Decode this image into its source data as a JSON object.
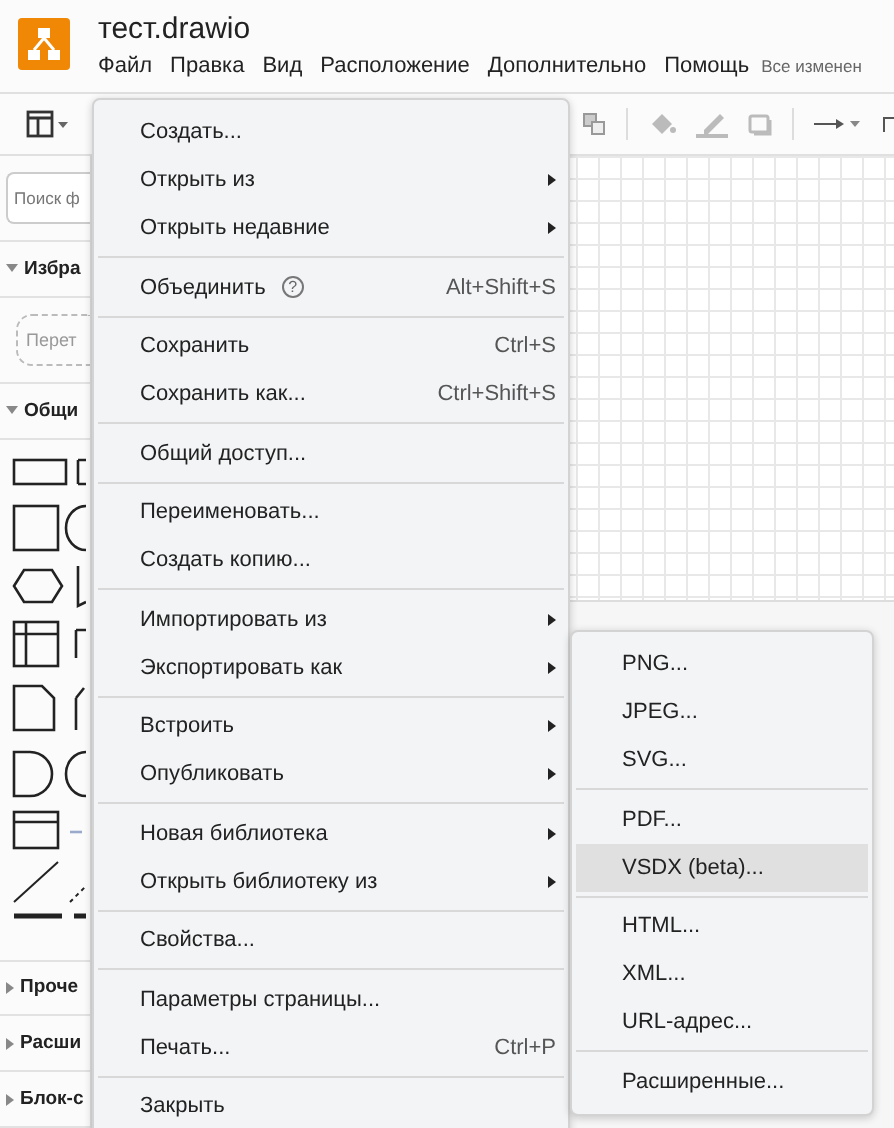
{
  "window": {
    "title": "тест.drawio"
  },
  "menubar": [
    {
      "label": "Файл"
    },
    {
      "label": "Правка"
    },
    {
      "label": "Вид"
    },
    {
      "label": "Расположение"
    },
    {
      "label": "Дополнительно"
    },
    {
      "label": "Помощь"
    }
  ],
  "save_status": "Все изменен",
  "sidebar": {
    "search": {
      "placeholder": "Поиск ф"
    },
    "sections": [
      {
        "title": "Избра",
        "expanded": true,
        "drop_hint": "Перет"
      },
      {
        "title": "Общи",
        "expanded": true,
        "shapes": true
      },
      {
        "title": "Проче",
        "expanded": false
      },
      {
        "title": "Расши",
        "expanded": false
      },
      {
        "title": "Блок-с",
        "expanded": false
      }
    ]
  },
  "file_menu": [
    {
      "kind": "item",
      "label": "Создать..."
    },
    {
      "kind": "item",
      "label": "Открыть из",
      "submenu": true
    },
    {
      "kind": "item",
      "label": "Открыть недавние",
      "submenu": true
    },
    {
      "kind": "separator"
    },
    {
      "kind": "item",
      "label": "Объединить",
      "help": "?",
      "shortcut": "Alt+Shift+S"
    },
    {
      "kind": "separator"
    },
    {
      "kind": "item",
      "label": "Сохранить",
      "shortcut": "Ctrl+S"
    },
    {
      "kind": "item",
      "label": "Сохранить как...",
      "shortcut": "Ctrl+Shift+S"
    },
    {
      "kind": "separator"
    },
    {
      "kind": "item",
      "label": "Общий доступ..."
    },
    {
      "kind": "separator"
    },
    {
      "kind": "item",
      "label": "Переименовать..."
    },
    {
      "kind": "item",
      "label": "Создать копию..."
    },
    {
      "kind": "separator"
    },
    {
      "kind": "item",
      "label": "Импортировать из",
      "submenu": true
    },
    {
      "kind": "item",
      "label": "Экспортировать как",
      "submenu": true
    },
    {
      "kind": "separator"
    },
    {
      "kind": "item",
      "label": "Встроить",
      "submenu": true
    },
    {
      "kind": "item",
      "label": "Опубликовать",
      "submenu": true
    },
    {
      "kind": "separator"
    },
    {
      "kind": "item",
      "label": "Новая библиотека",
      "submenu": true
    },
    {
      "kind": "item",
      "label": "Открыть библиотеку из",
      "submenu": true
    },
    {
      "kind": "separator"
    },
    {
      "kind": "item",
      "label": "Свойства..."
    },
    {
      "kind": "separator"
    },
    {
      "kind": "item",
      "label": "Параметры страницы..."
    },
    {
      "kind": "item",
      "label": "Печать...",
      "shortcut": "Ctrl+P"
    },
    {
      "kind": "separator"
    },
    {
      "kind": "item",
      "label": "Закрыть"
    }
  ],
  "export_submenu": [
    {
      "kind": "item",
      "label": "PNG...",
      "selected": false
    },
    {
      "kind": "item",
      "label": "JPEG...",
      "selected": false
    },
    {
      "kind": "item",
      "label": "SVG...",
      "selected": false
    },
    {
      "kind": "separator"
    },
    {
      "kind": "item",
      "label": "PDF...",
      "selected": false
    },
    {
      "kind": "item",
      "label": "VSDX (beta)...",
      "selected": true
    },
    {
      "kind": "separator"
    },
    {
      "kind": "item",
      "label": "HTML...",
      "selected": false
    },
    {
      "kind": "item",
      "label": "XML...",
      "selected": false
    },
    {
      "kind": "item",
      "label": "URL-адрес...",
      "selected": false
    },
    {
      "kind": "separator"
    },
    {
      "kind": "item",
      "label": "Расширенные...",
      "selected": false
    }
  ]
}
